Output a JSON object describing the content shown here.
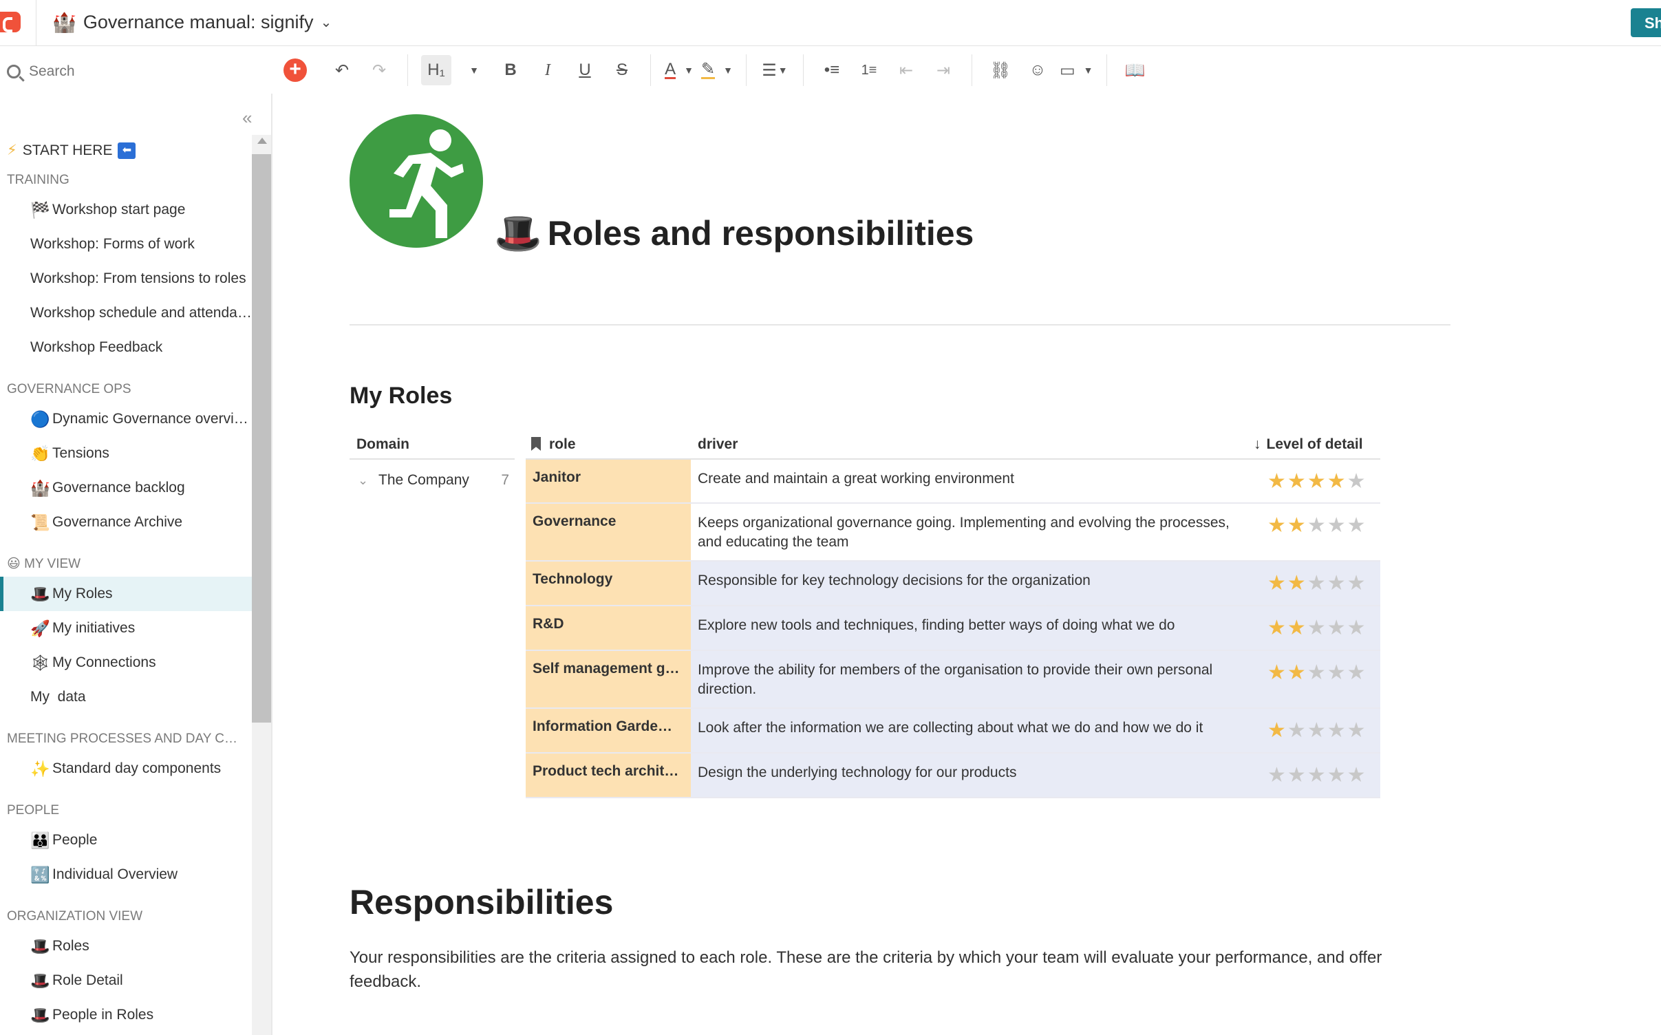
{
  "header": {
    "title": "Governance manual: signify",
    "title_emoji": "🏰",
    "share_label": "Sh"
  },
  "search": {
    "placeholder": "Search"
  },
  "toolbar": {
    "heading_label": "H₁",
    "bold": "B",
    "italic": "I",
    "underline": "U",
    "strike": "S",
    "text_color": "A"
  },
  "sidebar": {
    "start_here": "START HERE",
    "sections": [
      {
        "title": "TRAINING",
        "items": [
          {
            "emoji": "🏁",
            "label": "Workshop start page"
          },
          {
            "emoji": "",
            "label": "Workshop: Forms of work"
          },
          {
            "emoji": "",
            "label": "Workshop: From tensions to roles"
          },
          {
            "emoji": "",
            "label": "Workshop schedule and attendance"
          },
          {
            "emoji": "",
            "label": "Workshop Feedback"
          }
        ]
      },
      {
        "title": "GOVERNANCE OPS",
        "items": [
          {
            "emoji": "🔵",
            "label": "Dynamic Governance overview"
          },
          {
            "emoji": "👏",
            "label": "Tensions"
          },
          {
            "emoji": "🏰",
            "label": "Governance backlog"
          },
          {
            "emoji": "📜",
            "label": "Governance Archive"
          }
        ]
      },
      {
        "title": "MY VIEW",
        "emoji": "😃",
        "items": [
          {
            "emoji": "🎩",
            "label": "My Roles",
            "active": true
          },
          {
            "emoji": "🚀",
            "label": "My initiatives"
          },
          {
            "emoji": "🕸",
            "label": "My Connections"
          },
          {
            "emoji": "",
            "label": "My  data"
          }
        ]
      },
      {
        "title": "MEETING PROCESSES AND DAY COMPONENTS",
        "items": [
          {
            "emoji": "✨",
            "label": "Standard day components"
          }
        ]
      },
      {
        "title": "PEOPLE",
        "items": [
          {
            "emoji": "👪",
            "label": "People"
          },
          {
            "emoji": "🔣",
            "label": "Individual Overview"
          }
        ]
      },
      {
        "title": "ORGANIZATION VIEW",
        "items": [
          {
            "emoji": "🎩",
            "label": "Roles"
          },
          {
            "emoji": "🎩",
            "label": "Role Detail"
          },
          {
            "emoji": "🎩",
            "label": "People in Roles"
          }
        ]
      }
    ]
  },
  "page": {
    "title": "Roles and responsibilities",
    "title_emoji": "🎩",
    "hero_icon": "running-exit-icon",
    "my_roles_heading": "My Roles",
    "responsibilities_heading": "Responsibilities",
    "responsibilities_text": "Your responsibilities are the criteria assigned to each role. These are the criteria by which your team will evaluate your performance, and offer feedback."
  },
  "table": {
    "columns": {
      "domain": "Domain",
      "role": "role",
      "driver": "driver",
      "level": "Level of detail"
    },
    "group": {
      "label": "The Company",
      "count": "7"
    },
    "rows": [
      {
        "role": "Janitor",
        "driver": "Create and maintain a great working environment",
        "stars": 4
      },
      {
        "role": "Governance",
        "driver": "Keeps organizational governance going. Implementing and evolving the processes, and educating the team",
        "stars": 2
      },
      {
        "role": "Technology",
        "driver": "Responsible for key technology decisions for the organization",
        "stars": 2
      },
      {
        "role": "R&D",
        "driver": "Explore new tools and techniques, finding better ways of doing what we do",
        "stars": 2
      },
      {
        "role": "Self management g…",
        "driver": "Improve the ability for members of the organisation to provide their own personal direction.",
        "stars": 2
      },
      {
        "role": "Information Garde…",
        "driver": "Look after the information we are collecting about what we do and how we do it",
        "stars": 1
      },
      {
        "role": "Product tech archit…",
        "driver": "Design the underlying technology for our products",
        "stars": 0
      }
    ]
  },
  "colors": {
    "accent": "#1a8291",
    "brand": "#f0523a",
    "role_bg": "#fde1b3",
    "driver_bg": "#e8ebf6",
    "star": "#f2b945",
    "hero": "#3e9c43"
  }
}
